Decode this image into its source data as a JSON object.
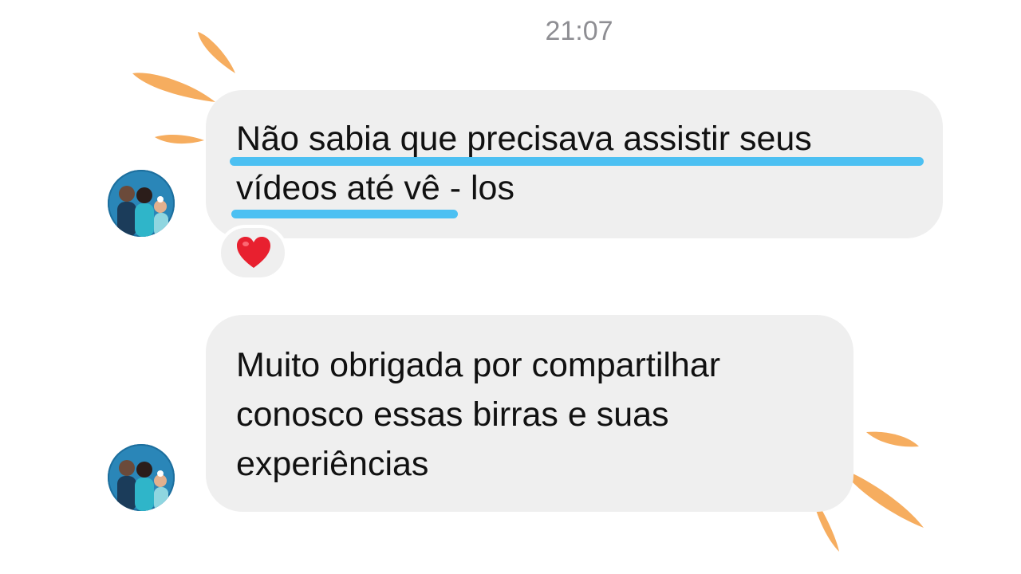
{
  "chat": {
    "timestamp": "21:07",
    "messages": [
      {
        "lines": [
          "Não sabia que precisava assistir seus",
          "vídeos até vê - los"
        ],
        "reaction": "heart-emoji"
      },
      {
        "lines": [
          "Muito obrigada por compartilhar",
          "conosco essas birras e suas",
          "experiências"
        ]
      }
    ]
  },
  "colors": {
    "bubble": "#efefef",
    "underline_highlight": "#4cc0f2",
    "accent_rays": "#f6ad5f",
    "timestamp": "#8e8e93"
  }
}
